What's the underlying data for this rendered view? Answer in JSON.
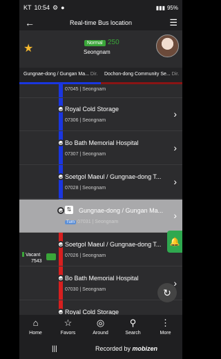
{
  "status": {
    "carrier": "KT",
    "time": "10:54",
    "battery": "95%"
  },
  "header": {
    "title": "Real-time Bus location"
  },
  "route": {
    "badge": "Normal",
    "number": "250",
    "city": "Seongnam"
  },
  "directions": [
    {
      "name": "Gungnae-dong / Gungan Ma...",
      "suffix": "Dir."
    },
    {
      "name": "Dochon-dong Community Se...",
      "suffix": "Dir."
    }
  ],
  "stops": [
    {
      "name": "",
      "sub": "07045 | Seongnam"
    },
    {
      "name": "Royal Cold Storage",
      "sub": "07306 | Seongnam"
    },
    {
      "name": "Bo Bath Memorial Hospital",
      "sub": "07307 | Seongnam"
    },
    {
      "name": "Soetgol Maeul / Gungnae-dong T...",
      "sub": "07028 | Seongnam"
    },
    {
      "name": "Gungnae-dong / Gungan Ma...",
      "turn": "Turn",
      "sub": "07031 | Seongnam"
    },
    {
      "name": "Soetgol Maeul / Gungnae-dong T...",
      "sub": "07026 | Seongnam"
    },
    {
      "name": "Bo Bath Memorial Hospital",
      "sub": "07030 | Seongnam"
    },
    {
      "name": "Royal Cold Storage",
      "sub": ""
    }
  ],
  "bus": {
    "status": "Vacant",
    "plate": "7543"
  },
  "nav": [
    {
      "label": "Home",
      "icon": "⌂"
    },
    {
      "label": "Favors",
      "icon": "☆"
    },
    {
      "label": "Around",
      "icon": "◎"
    },
    {
      "label": "Search",
      "icon": "⚲"
    },
    {
      "label": "More",
      "icon": "⋮"
    }
  ],
  "system": {
    "recents": "|||"
  },
  "watermark": {
    "prefix": "Recorded by",
    "brand": "mobizen"
  },
  "colors": {
    "up_line": "#1a36e0",
    "down_line": "#d71f1f",
    "accent": "#3aa639"
  }
}
